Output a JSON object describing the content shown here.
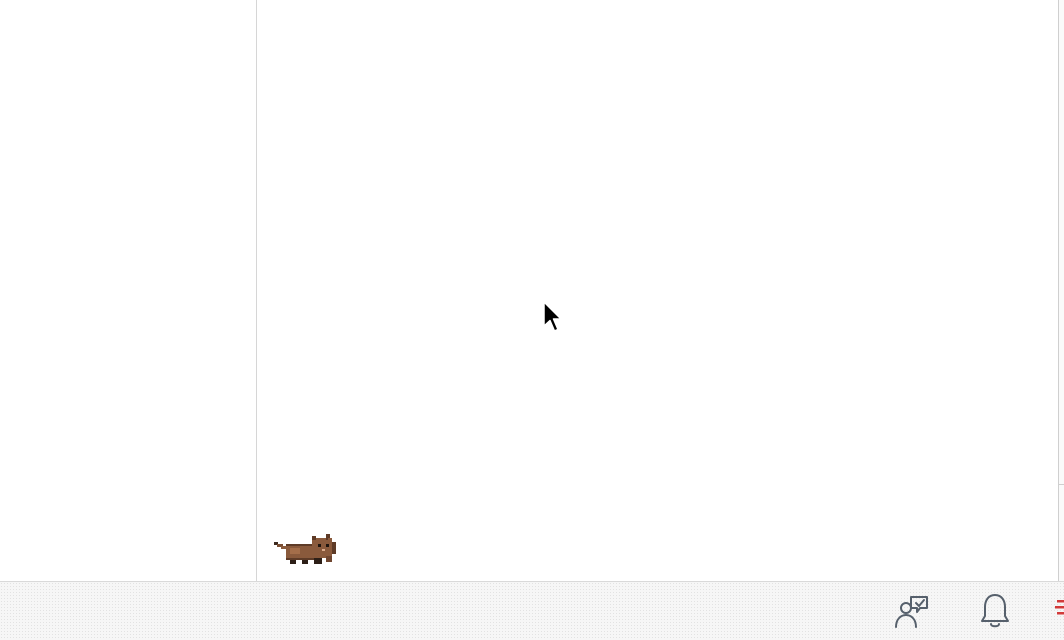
{
  "window": {
    "left_pane": "",
    "main_pane": ""
  },
  "taskbar": {
    "items": [
      {
        "name": "people-chat-icon"
      },
      {
        "name": "bell-icon"
      },
      {
        "name": "partial-red-icon"
      }
    ]
  },
  "icons": {
    "cursor": "mouse-pointer",
    "pet": "brown-cat-pixel"
  },
  "colors": {
    "icon_stroke": "#56606c",
    "pet_fur": "#8a5a3c",
    "partial_icon": "#d23a3a"
  }
}
